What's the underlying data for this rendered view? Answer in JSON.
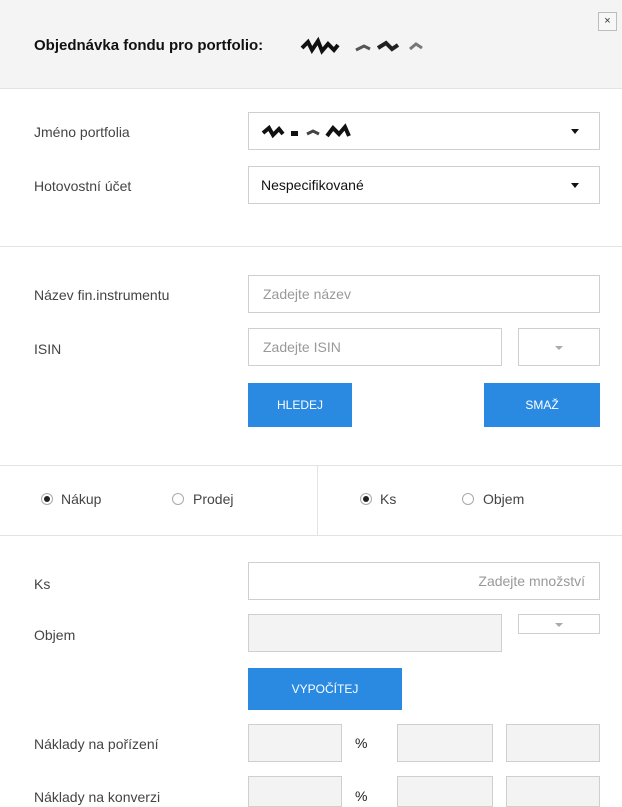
{
  "dialog": {
    "title": "Objednávka fondu pro portfolio:",
    "close_glyph": "×"
  },
  "portfolio": {
    "name_label": "Jméno portfolia",
    "cash_label": "Hotovostní účet",
    "cash_value": "Nespecifikované"
  },
  "search": {
    "name_label": "Název fin.instrumentu",
    "name_placeholder": "Zadejte název",
    "isin_label": "ISIN",
    "isin_placeholder": "Zadejte ISIN",
    "search_button": "HLEDEJ",
    "clear_button": "SMAŽ"
  },
  "direction": {
    "buy_label": "Nákup",
    "sell_label": "Prodej",
    "selected": "Nákup"
  },
  "mode": {
    "pieces_label": "Ks",
    "volume_label": "Objem",
    "selected": "Ks"
  },
  "amount": {
    "pieces_label": "Ks",
    "pieces_placeholder": "Zadejte množství",
    "volume_label": "Objem",
    "calculate_button": "VYPOČÍTEJ"
  },
  "fees": {
    "acquisition_label": "Náklady na pořízení",
    "conversion_label": "Náklady na konverzi",
    "percent": "%"
  },
  "colors": {
    "accent": "#2a8ae2",
    "header_bg": "#f4f4f4",
    "border": "#cfcfcf"
  }
}
